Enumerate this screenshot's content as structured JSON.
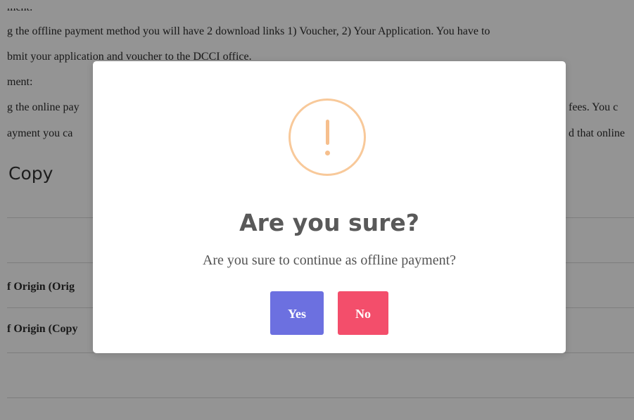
{
  "background": {
    "lines": [
      "ment:",
      "g the offline payment method you will have 2 download links 1) Voucher, 2) Your Application. You have to",
      "bmit your application and voucher to the DCCI office.",
      "ment:",
      "g the online pay",
      "fees. You c",
      "ayment you ca",
      "d that online"
    ],
    "section_title": "Copy",
    "rows": [
      "f Origin (Orig",
      "f Origin (Copy"
    ]
  },
  "dialog": {
    "icon": "warning-exclamation-icon",
    "icon_color": "#f8bb86",
    "title": "Are you sure?",
    "message": "Are you sure to continue as offline payment?",
    "confirm_label": "Yes",
    "cancel_label": "No",
    "confirm_color": "#6c70e0",
    "cancel_color": "#f34e6b"
  }
}
